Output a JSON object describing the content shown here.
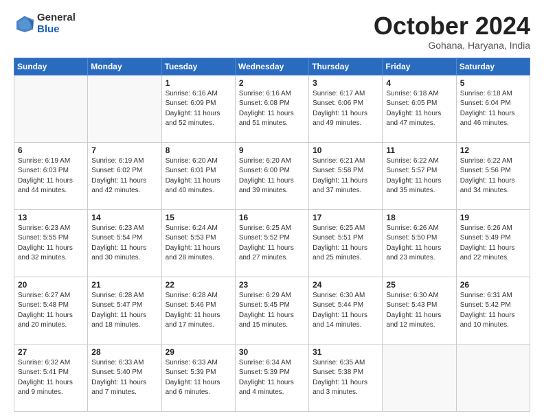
{
  "header": {
    "logo_general": "General",
    "logo_blue": "Blue",
    "month_title": "October 2024",
    "location": "Gohana, Haryana, India"
  },
  "weekdays": [
    "Sunday",
    "Monday",
    "Tuesday",
    "Wednesday",
    "Thursday",
    "Friday",
    "Saturday"
  ],
  "weeks": [
    [
      {
        "day": "",
        "sunrise": "",
        "sunset": "",
        "daylight": ""
      },
      {
        "day": "",
        "sunrise": "",
        "sunset": "",
        "daylight": ""
      },
      {
        "day": "1",
        "sunrise": "Sunrise: 6:16 AM",
        "sunset": "Sunset: 6:09 PM",
        "daylight": "Daylight: 11 hours and 52 minutes."
      },
      {
        "day": "2",
        "sunrise": "Sunrise: 6:16 AM",
        "sunset": "Sunset: 6:08 PM",
        "daylight": "Daylight: 11 hours and 51 minutes."
      },
      {
        "day": "3",
        "sunrise": "Sunrise: 6:17 AM",
        "sunset": "Sunset: 6:06 PM",
        "daylight": "Daylight: 11 hours and 49 minutes."
      },
      {
        "day": "4",
        "sunrise": "Sunrise: 6:18 AM",
        "sunset": "Sunset: 6:05 PM",
        "daylight": "Daylight: 11 hours and 47 minutes."
      },
      {
        "day": "5",
        "sunrise": "Sunrise: 6:18 AM",
        "sunset": "Sunset: 6:04 PM",
        "daylight": "Daylight: 11 hours and 46 minutes."
      }
    ],
    [
      {
        "day": "6",
        "sunrise": "Sunrise: 6:19 AM",
        "sunset": "Sunset: 6:03 PM",
        "daylight": "Daylight: 11 hours and 44 minutes."
      },
      {
        "day": "7",
        "sunrise": "Sunrise: 6:19 AM",
        "sunset": "Sunset: 6:02 PM",
        "daylight": "Daylight: 11 hours and 42 minutes."
      },
      {
        "day": "8",
        "sunrise": "Sunrise: 6:20 AM",
        "sunset": "Sunset: 6:01 PM",
        "daylight": "Daylight: 11 hours and 40 minutes."
      },
      {
        "day": "9",
        "sunrise": "Sunrise: 6:20 AM",
        "sunset": "Sunset: 6:00 PM",
        "daylight": "Daylight: 11 hours and 39 minutes."
      },
      {
        "day": "10",
        "sunrise": "Sunrise: 6:21 AM",
        "sunset": "Sunset: 5:58 PM",
        "daylight": "Daylight: 11 hours and 37 minutes."
      },
      {
        "day": "11",
        "sunrise": "Sunrise: 6:22 AM",
        "sunset": "Sunset: 5:57 PM",
        "daylight": "Daylight: 11 hours and 35 minutes."
      },
      {
        "day": "12",
        "sunrise": "Sunrise: 6:22 AM",
        "sunset": "Sunset: 5:56 PM",
        "daylight": "Daylight: 11 hours and 34 minutes."
      }
    ],
    [
      {
        "day": "13",
        "sunrise": "Sunrise: 6:23 AM",
        "sunset": "Sunset: 5:55 PM",
        "daylight": "Daylight: 11 hours and 32 minutes."
      },
      {
        "day": "14",
        "sunrise": "Sunrise: 6:23 AM",
        "sunset": "Sunset: 5:54 PM",
        "daylight": "Daylight: 11 hours and 30 minutes."
      },
      {
        "day": "15",
        "sunrise": "Sunrise: 6:24 AM",
        "sunset": "Sunset: 5:53 PM",
        "daylight": "Daylight: 11 hours and 28 minutes."
      },
      {
        "day": "16",
        "sunrise": "Sunrise: 6:25 AM",
        "sunset": "Sunset: 5:52 PM",
        "daylight": "Daylight: 11 hours and 27 minutes."
      },
      {
        "day": "17",
        "sunrise": "Sunrise: 6:25 AM",
        "sunset": "Sunset: 5:51 PM",
        "daylight": "Daylight: 11 hours and 25 minutes."
      },
      {
        "day": "18",
        "sunrise": "Sunrise: 6:26 AM",
        "sunset": "Sunset: 5:50 PM",
        "daylight": "Daylight: 11 hours and 23 minutes."
      },
      {
        "day": "19",
        "sunrise": "Sunrise: 6:26 AM",
        "sunset": "Sunset: 5:49 PM",
        "daylight": "Daylight: 11 hours and 22 minutes."
      }
    ],
    [
      {
        "day": "20",
        "sunrise": "Sunrise: 6:27 AM",
        "sunset": "Sunset: 5:48 PM",
        "daylight": "Daylight: 11 hours and 20 minutes."
      },
      {
        "day": "21",
        "sunrise": "Sunrise: 6:28 AM",
        "sunset": "Sunset: 5:47 PM",
        "daylight": "Daylight: 11 hours and 18 minutes."
      },
      {
        "day": "22",
        "sunrise": "Sunrise: 6:28 AM",
        "sunset": "Sunset: 5:46 PM",
        "daylight": "Daylight: 11 hours and 17 minutes."
      },
      {
        "day": "23",
        "sunrise": "Sunrise: 6:29 AM",
        "sunset": "Sunset: 5:45 PM",
        "daylight": "Daylight: 11 hours and 15 minutes."
      },
      {
        "day": "24",
        "sunrise": "Sunrise: 6:30 AM",
        "sunset": "Sunset: 5:44 PM",
        "daylight": "Daylight: 11 hours and 14 minutes."
      },
      {
        "day": "25",
        "sunrise": "Sunrise: 6:30 AM",
        "sunset": "Sunset: 5:43 PM",
        "daylight": "Daylight: 11 hours and 12 minutes."
      },
      {
        "day": "26",
        "sunrise": "Sunrise: 6:31 AM",
        "sunset": "Sunset: 5:42 PM",
        "daylight": "Daylight: 11 hours and 10 minutes."
      }
    ],
    [
      {
        "day": "27",
        "sunrise": "Sunrise: 6:32 AM",
        "sunset": "Sunset: 5:41 PM",
        "daylight": "Daylight: 11 hours and 9 minutes."
      },
      {
        "day": "28",
        "sunrise": "Sunrise: 6:33 AM",
        "sunset": "Sunset: 5:40 PM",
        "daylight": "Daylight: 11 hours and 7 minutes."
      },
      {
        "day": "29",
        "sunrise": "Sunrise: 6:33 AM",
        "sunset": "Sunset: 5:39 PM",
        "daylight": "Daylight: 11 hours and 6 minutes."
      },
      {
        "day": "30",
        "sunrise": "Sunrise: 6:34 AM",
        "sunset": "Sunset: 5:39 PM",
        "daylight": "Daylight: 11 hours and 4 minutes."
      },
      {
        "day": "31",
        "sunrise": "Sunrise: 6:35 AM",
        "sunset": "Sunset: 5:38 PM",
        "daylight": "Daylight: 11 hours and 3 minutes."
      },
      {
        "day": "",
        "sunrise": "",
        "sunset": "",
        "daylight": ""
      },
      {
        "day": "",
        "sunrise": "",
        "sunset": "",
        "daylight": ""
      }
    ]
  ]
}
